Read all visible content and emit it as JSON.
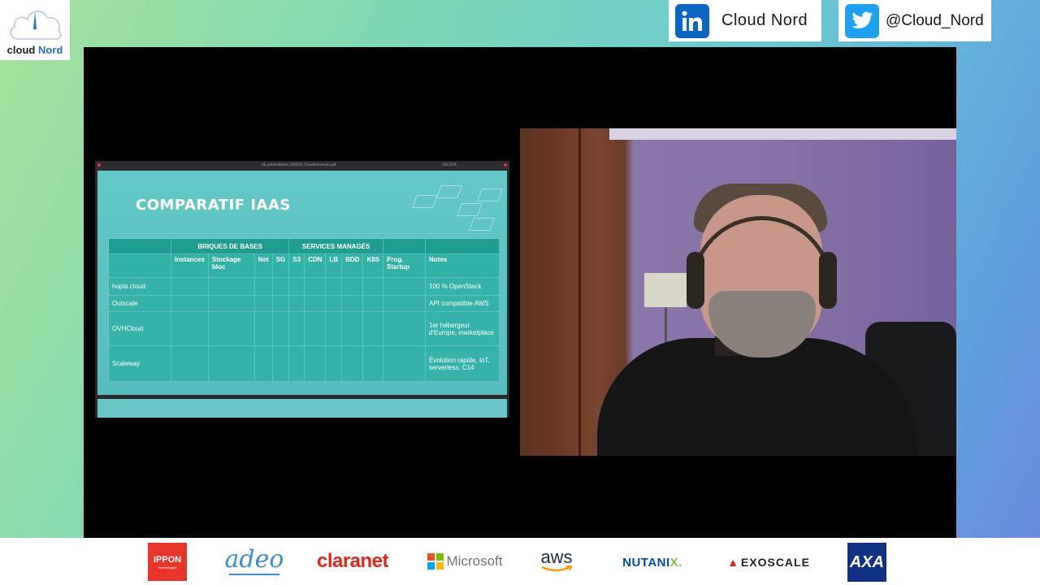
{
  "brand": {
    "logo_text_a": "cloud",
    "logo_text_b": "Nord"
  },
  "social": {
    "linkedin_label": "Cloud  Nord",
    "twitter_label": "@Cloud_Nord",
    "linkedin_icon": "linkedin-icon",
    "twitter_icon": "twitter-icon"
  },
  "slide": {
    "window_title": "06_présentation_CN2020_CloudSouverain.pdf",
    "zoom": "156.51%",
    "title": "COMPARATIF IAAS",
    "group_headers": [
      "BRIQUES DE BASES",
      "SERVICES MANAGÉS"
    ],
    "columns": [
      "Instances",
      "Stockage bloc",
      "Net",
      "SG",
      "S3",
      "CDN",
      "LB",
      "BDD",
      "K8S",
      "Prog. Startup",
      "Notes"
    ],
    "rows": [
      {
        "name": "hopla.cloud",
        "note": "100 % OpenStack"
      },
      {
        "name": "Outscale",
        "note": "API compatible AWS"
      },
      {
        "name": "OVHCloud",
        "note": "1er hébergeur d'Europe, marketplace"
      },
      {
        "name": "Scaleway",
        "note": "Évolution rapide, IoT, serverless, C14"
      }
    ]
  },
  "sponsors": {
    "ippon": "IPPON",
    "ippon_sub": "Technologies",
    "adeo": "adeo",
    "claranet": "claranet",
    "microsoft": "Microsoft",
    "aws": "aws",
    "nutanix_a": "NUTANI",
    "nutanix_b": "X.",
    "exoscale": "EXOSCALE",
    "axa": "AXA"
  },
  "colors": {
    "linkedin": "#0a66c2",
    "twitter": "#1da1f2",
    "slide_teal": "#5cc3c3",
    "claranet_red": "#e1261c"
  }
}
